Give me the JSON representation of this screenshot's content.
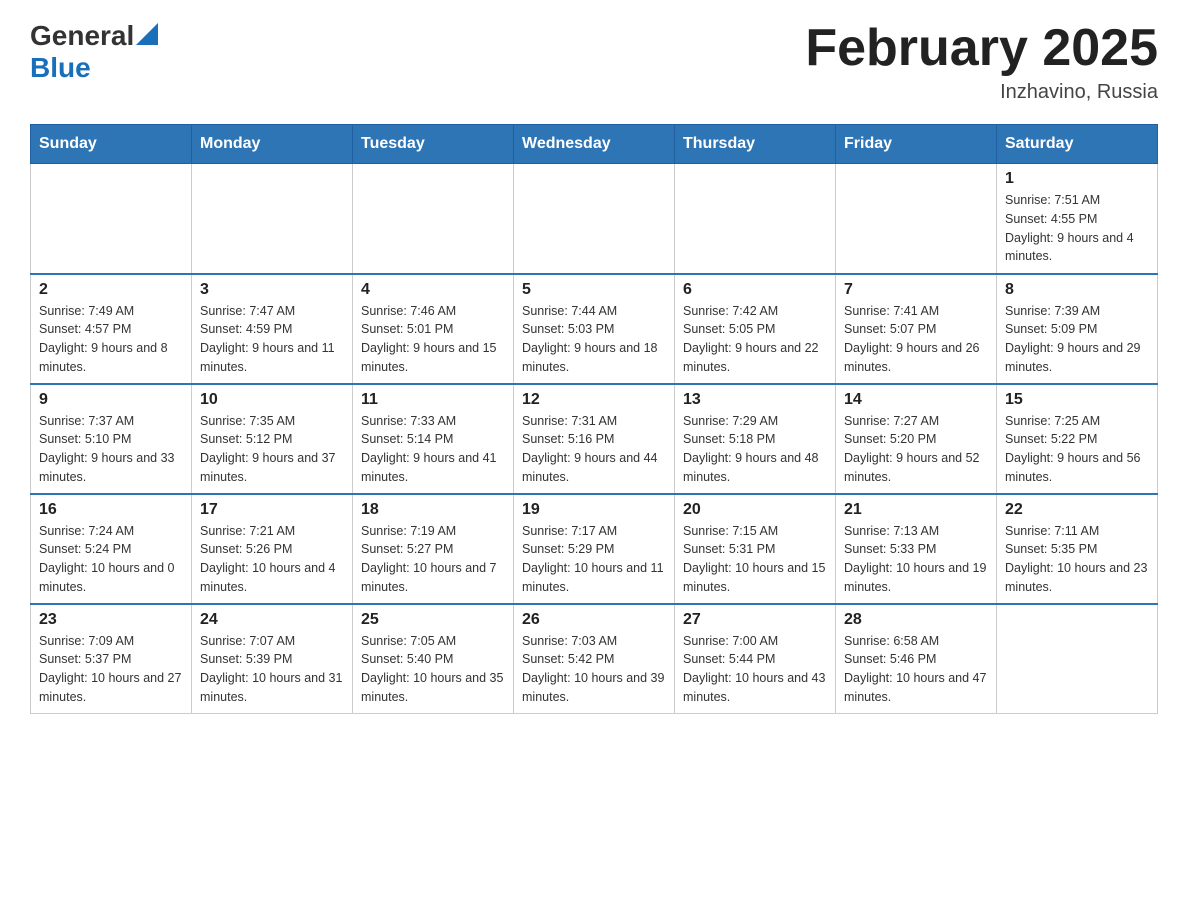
{
  "header": {
    "logo_general": "General",
    "logo_blue": "Blue",
    "month_title": "February 2025",
    "location": "Inzhavino, Russia"
  },
  "weekdays": [
    "Sunday",
    "Monday",
    "Tuesday",
    "Wednesday",
    "Thursday",
    "Friday",
    "Saturday"
  ],
  "weeks": [
    [
      {
        "day": "",
        "info": ""
      },
      {
        "day": "",
        "info": ""
      },
      {
        "day": "",
        "info": ""
      },
      {
        "day": "",
        "info": ""
      },
      {
        "day": "",
        "info": ""
      },
      {
        "day": "",
        "info": ""
      },
      {
        "day": "1",
        "info": "Sunrise: 7:51 AM\nSunset: 4:55 PM\nDaylight: 9 hours and 4 minutes."
      }
    ],
    [
      {
        "day": "2",
        "info": "Sunrise: 7:49 AM\nSunset: 4:57 PM\nDaylight: 9 hours and 8 minutes."
      },
      {
        "day": "3",
        "info": "Sunrise: 7:47 AM\nSunset: 4:59 PM\nDaylight: 9 hours and 11 minutes."
      },
      {
        "day": "4",
        "info": "Sunrise: 7:46 AM\nSunset: 5:01 PM\nDaylight: 9 hours and 15 minutes."
      },
      {
        "day": "5",
        "info": "Sunrise: 7:44 AM\nSunset: 5:03 PM\nDaylight: 9 hours and 18 minutes."
      },
      {
        "day": "6",
        "info": "Sunrise: 7:42 AM\nSunset: 5:05 PM\nDaylight: 9 hours and 22 minutes."
      },
      {
        "day": "7",
        "info": "Sunrise: 7:41 AM\nSunset: 5:07 PM\nDaylight: 9 hours and 26 minutes."
      },
      {
        "day": "8",
        "info": "Sunrise: 7:39 AM\nSunset: 5:09 PM\nDaylight: 9 hours and 29 minutes."
      }
    ],
    [
      {
        "day": "9",
        "info": "Sunrise: 7:37 AM\nSunset: 5:10 PM\nDaylight: 9 hours and 33 minutes."
      },
      {
        "day": "10",
        "info": "Sunrise: 7:35 AM\nSunset: 5:12 PM\nDaylight: 9 hours and 37 minutes."
      },
      {
        "day": "11",
        "info": "Sunrise: 7:33 AM\nSunset: 5:14 PM\nDaylight: 9 hours and 41 minutes."
      },
      {
        "day": "12",
        "info": "Sunrise: 7:31 AM\nSunset: 5:16 PM\nDaylight: 9 hours and 44 minutes."
      },
      {
        "day": "13",
        "info": "Sunrise: 7:29 AM\nSunset: 5:18 PM\nDaylight: 9 hours and 48 minutes."
      },
      {
        "day": "14",
        "info": "Sunrise: 7:27 AM\nSunset: 5:20 PM\nDaylight: 9 hours and 52 minutes."
      },
      {
        "day": "15",
        "info": "Sunrise: 7:25 AM\nSunset: 5:22 PM\nDaylight: 9 hours and 56 minutes."
      }
    ],
    [
      {
        "day": "16",
        "info": "Sunrise: 7:24 AM\nSunset: 5:24 PM\nDaylight: 10 hours and 0 minutes."
      },
      {
        "day": "17",
        "info": "Sunrise: 7:21 AM\nSunset: 5:26 PM\nDaylight: 10 hours and 4 minutes."
      },
      {
        "day": "18",
        "info": "Sunrise: 7:19 AM\nSunset: 5:27 PM\nDaylight: 10 hours and 7 minutes."
      },
      {
        "day": "19",
        "info": "Sunrise: 7:17 AM\nSunset: 5:29 PM\nDaylight: 10 hours and 11 minutes."
      },
      {
        "day": "20",
        "info": "Sunrise: 7:15 AM\nSunset: 5:31 PM\nDaylight: 10 hours and 15 minutes."
      },
      {
        "day": "21",
        "info": "Sunrise: 7:13 AM\nSunset: 5:33 PM\nDaylight: 10 hours and 19 minutes."
      },
      {
        "day": "22",
        "info": "Sunrise: 7:11 AM\nSunset: 5:35 PM\nDaylight: 10 hours and 23 minutes."
      }
    ],
    [
      {
        "day": "23",
        "info": "Sunrise: 7:09 AM\nSunset: 5:37 PM\nDaylight: 10 hours and 27 minutes."
      },
      {
        "day": "24",
        "info": "Sunrise: 7:07 AM\nSunset: 5:39 PM\nDaylight: 10 hours and 31 minutes."
      },
      {
        "day": "25",
        "info": "Sunrise: 7:05 AM\nSunset: 5:40 PM\nDaylight: 10 hours and 35 minutes."
      },
      {
        "day": "26",
        "info": "Sunrise: 7:03 AM\nSunset: 5:42 PM\nDaylight: 10 hours and 39 minutes."
      },
      {
        "day": "27",
        "info": "Sunrise: 7:00 AM\nSunset: 5:44 PM\nDaylight: 10 hours and 43 minutes."
      },
      {
        "day": "28",
        "info": "Sunrise: 6:58 AM\nSunset: 5:46 PM\nDaylight: 10 hours and 47 minutes."
      },
      {
        "day": "",
        "info": ""
      }
    ]
  ]
}
